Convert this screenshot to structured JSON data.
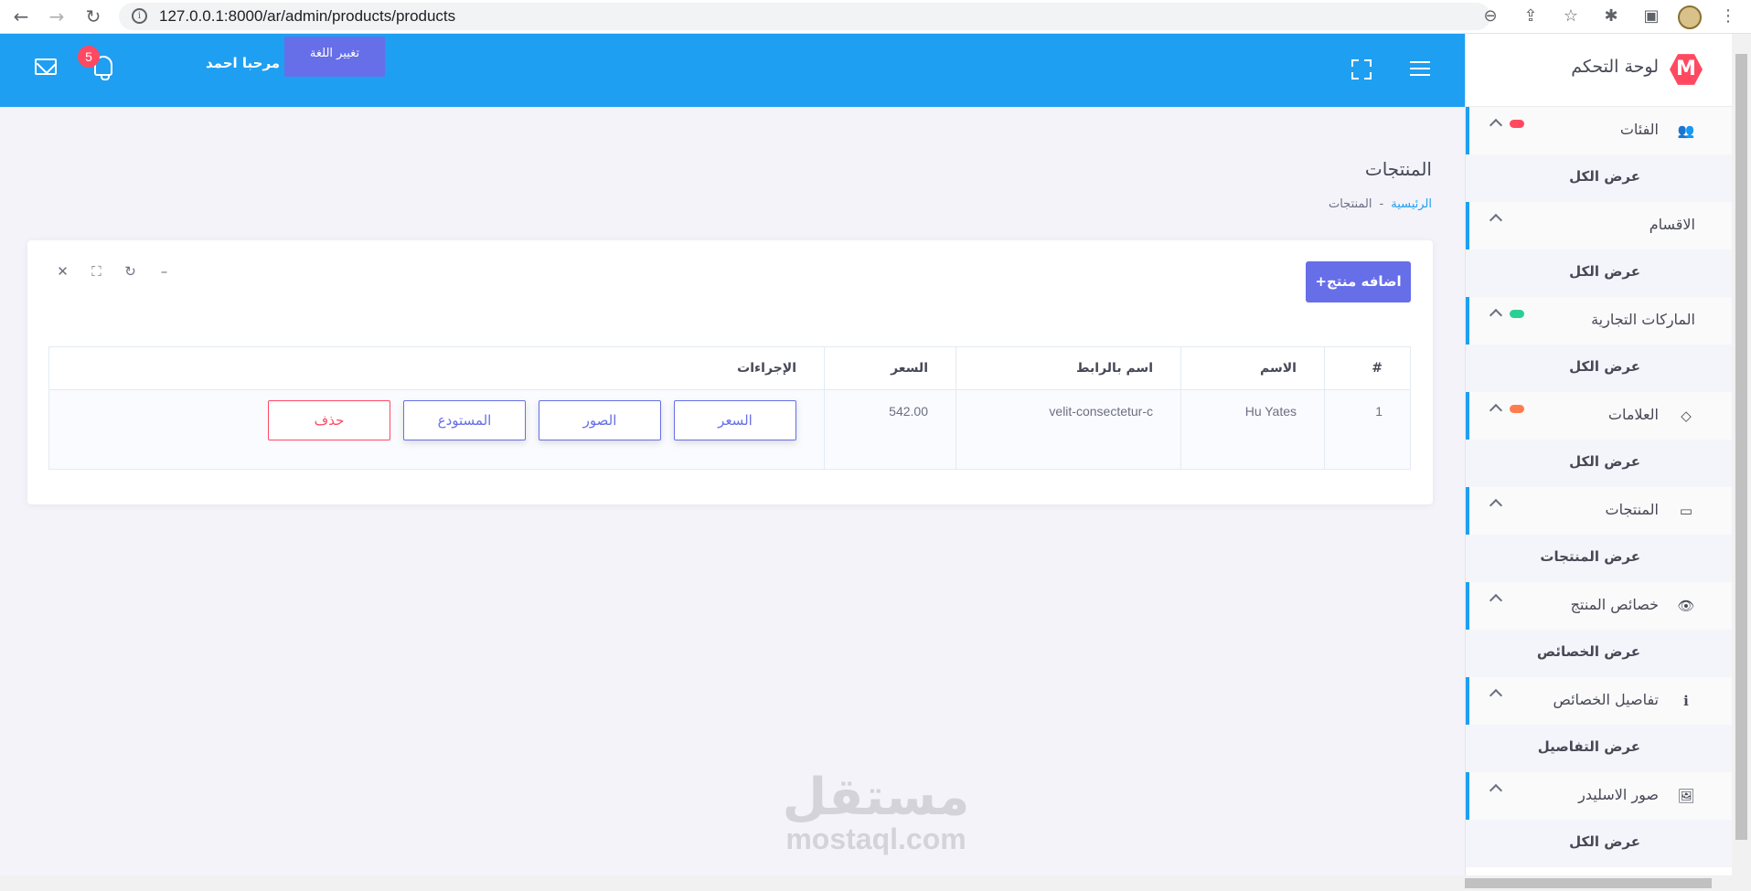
{
  "browser": {
    "url": "127.0.0.1:8000/ar/admin/products/products",
    "back": "←",
    "forward": "→",
    "reload": "↻",
    "zoom": "⊖",
    "share": "⇪",
    "star": "☆",
    "ext": "✱",
    "panel": "▣",
    "kebab": "⋮"
  },
  "header": {
    "notification_count": "5",
    "greeting": "مرحبا احمد",
    "lang_button": "تغيير اللغة"
  },
  "sidebar": {
    "brand_letter": "M",
    "brand_title": "لوحة التحكم",
    "sections": [
      {
        "label": "الفئات",
        "icon": "users-icon",
        "glyph": "👥",
        "dot": "#ff4961",
        "sub": "عرض الكل"
      },
      {
        "label": "الاقسام",
        "icon": "",
        "glyph": "",
        "dot": "",
        "sub": "عرض الكل"
      },
      {
        "label": "الماركات التجارية",
        "icon": "",
        "glyph": "",
        "dot": "#28d094",
        "sub": "عرض الكل"
      },
      {
        "label": "العلامات",
        "icon": "tag-icon",
        "glyph": "◇",
        "dot": "#ff7d4d",
        "sub": "عرض الكل"
      },
      {
        "label": "المنتجات",
        "icon": "ticket-icon",
        "glyph": "▭",
        "dot": "",
        "sub": "عرض المنتجات"
      },
      {
        "label": "خصائص المنتج",
        "icon": "eye-icon",
        "glyph": "👁",
        "dot": "",
        "sub": "عرض الخصائص"
      },
      {
        "label": "تفاصيل الخصائص",
        "icon": "info-icon",
        "glyph": "ℹ",
        "dot": "",
        "sub": "عرض التفاصيل"
      },
      {
        "label": "صور الاسليدر",
        "icon": "image-icon",
        "glyph": "🖼",
        "dot": "",
        "sub": "عرض الكل"
      }
    ]
  },
  "content": {
    "page_title": "المنتجات",
    "breadcrumb_home": "الرئيسية",
    "breadcrumb_sep": "-",
    "breadcrumb_current": "المنتجات",
    "add_button": "+اضافه منتج",
    "tools": {
      "close": "✕",
      "expand": "⛶",
      "refresh": "↻",
      "collapse": "–"
    },
    "table": {
      "headers": [
        "#",
        "الاسم",
        "اسم بالرابط",
        "السعر",
        "الإجراءات"
      ],
      "rows": [
        {
          "num": "1",
          "name": "Hu Yates",
          "slug": "velit-consectetur-c",
          "price": "542.00"
        }
      ],
      "actions": {
        "price": "السعر",
        "images": "الصور",
        "stock": "المستودع",
        "delete": "حذف"
      }
    }
  },
  "watermark": {
    "ar": "مستقل",
    "en": "mostaql.com"
  }
}
